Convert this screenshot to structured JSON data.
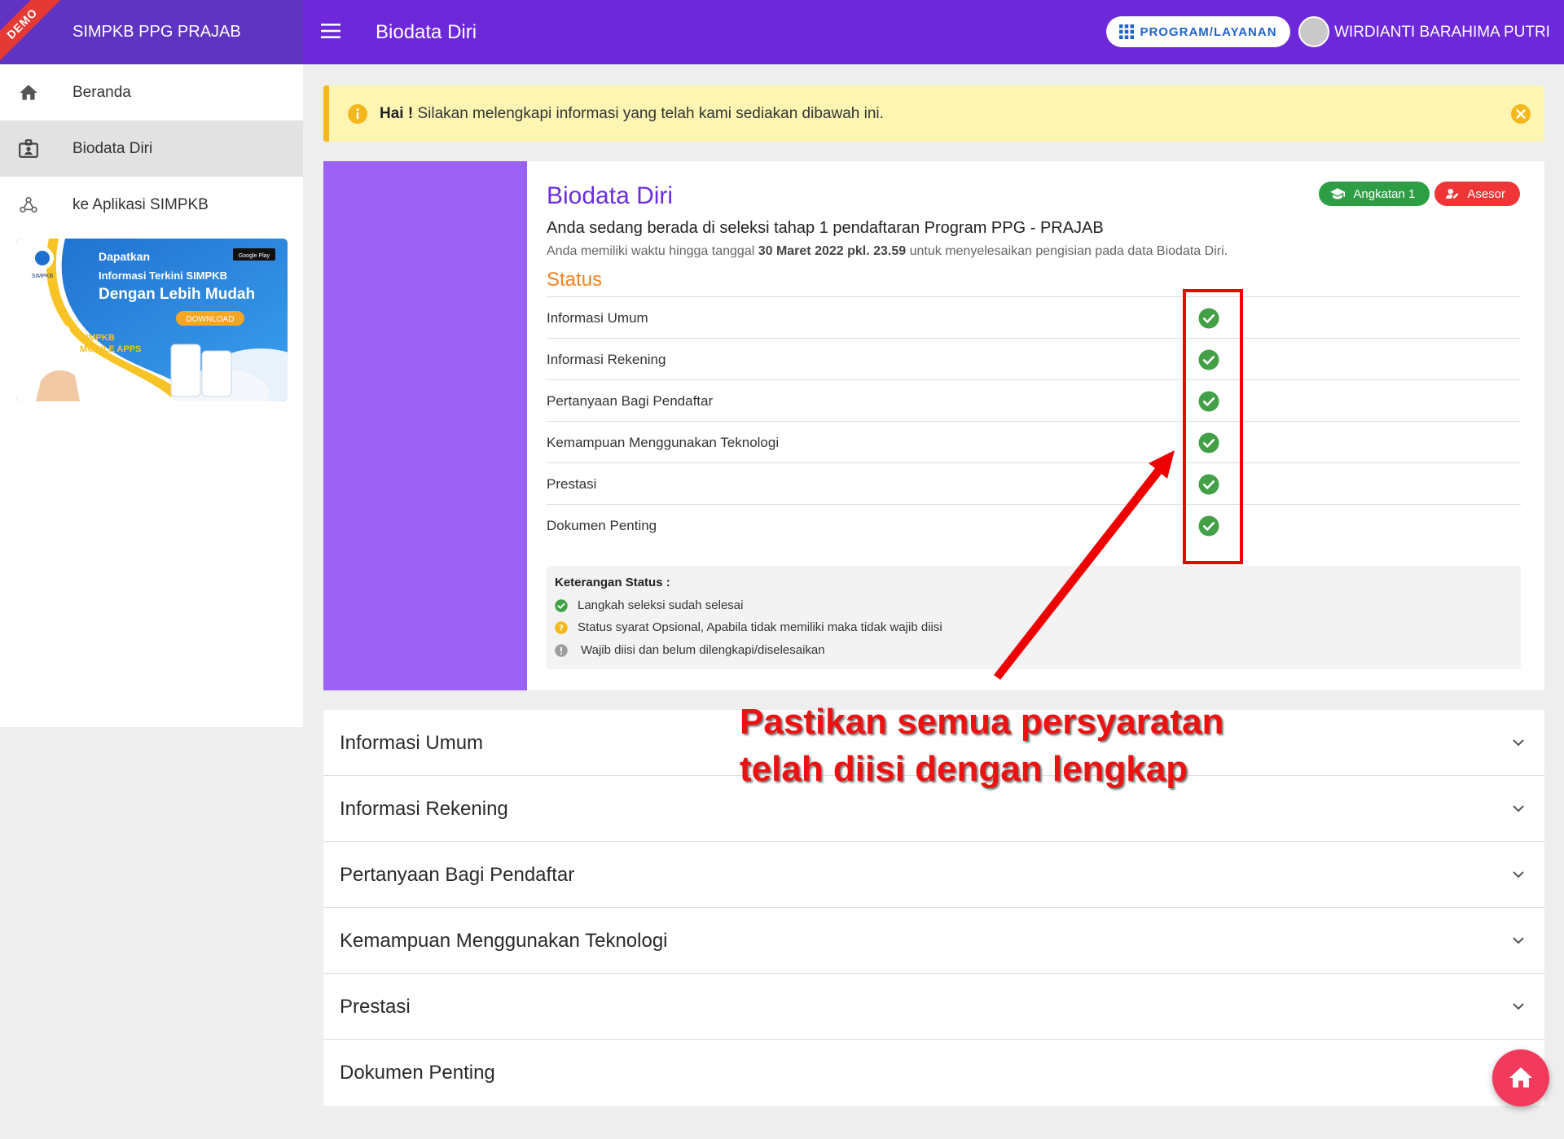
{
  "sidebar": {
    "demo_ribbon": "DEMO",
    "brand_title": "SIMPKB PPG PRAJAB",
    "items": [
      {
        "label": "Beranda",
        "icon": "home-icon"
      },
      {
        "label": "Biodata Diri",
        "icon": "id-badge-icon",
        "active": true
      },
      {
        "label": "ke Aplikasi SIMPKB",
        "icon": "webhook-icon"
      }
    ],
    "promo": {
      "line1": "Dapatkan",
      "line2": "Informasi Terkini SIMPKB",
      "line3": "Dengan Lebih Mudah",
      "download": "DOWNLOAD",
      "apps1": "SIMPKB",
      "apps2": "MOBILE APPS",
      "logo_text": "SIMPKB",
      "store_text": "Google Play"
    }
  },
  "topbar": {
    "page_title": "Biodata Diri",
    "program_button": "PROGRAM/LAYANAN",
    "user_name": "WIRDIANTI BARAHIMA PUTRI"
  },
  "alert": {
    "bold": "Hai !",
    "text": " Silakan melengkapi informasi yang telah kami sediakan dibawah ini."
  },
  "card": {
    "title": "Biodata Diri",
    "badges": {
      "angkatan": "Angkatan 1",
      "asesor": "Asesor"
    },
    "subtitle": "Anda sedang berada di seleksi tahap 1 pendaftaran Program PPG - PRAJAB",
    "deadline_prefix": "Anda memiliki waktu hingga tanggal ",
    "deadline_date": "30 Maret 2022 pkl. 23.59",
    "deadline_suffix": " untuk menyelesaikan pengisian pada data Biodata Diri.",
    "status_heading": "Status",
    "status_items": [
      {
        "name": "Informasi Umum",
        "status": "complete"
      },
      {
        "name": "Informasi Rekening",
        "status": "complete"
      },
      {
        "name": "Pertanyaan Bagi Pendaftar",
        "status": "complete"
      },
      {
        "name": "Kemampuan Menggunakan Teknologi",
        "status": "complete"
      },
      {
        "name": "Prestasi",
        "status": "complete"
      },
      {
        "name": "Dokumen Penting",
        "status": "complete"
      }
    ],
    "legend": {
      "title": "Keterangan Status :",
      "done": "Langkah seleksi sudah selesai",
      "optional": "Status syarat Opsional, Apabila tidak memiliki maka tidak wajib diisi",
      "required": "Wajib diisi dan belum dilengkapi/diselesaikan"
    }
  },
  "accordion": [
    "Informasi Umum",
    "Informasi Rekening",
    "Pertanyaan Bagi Pendaftar",
    "Kemampuan Menggunakan Teknologi",
    "Prestasi",
    "Dokumen Penting"
  ],
  "annotation": {
    "line1": "Pastikan semua persyaratan",
    "line2": "telah diisi dengan lengkap"
  },
  "colors": {
    "sidebar_brand": "#5f34c1",
    "topbar": "#6d28d9",
    "card_accent": "#9c62f4",
    "title_purple": "#6a2ee0",
    "status_orange": "#f5811f",
    "check_green": "#43a047",
    "badge_green": "#2e9e45",
    "badge_red": "#ef3535",
    "alert_bg": "#fdf6b2",
    "fab": "#f23a5c",
    "annotation_red": "#ee0000"
  }
}
